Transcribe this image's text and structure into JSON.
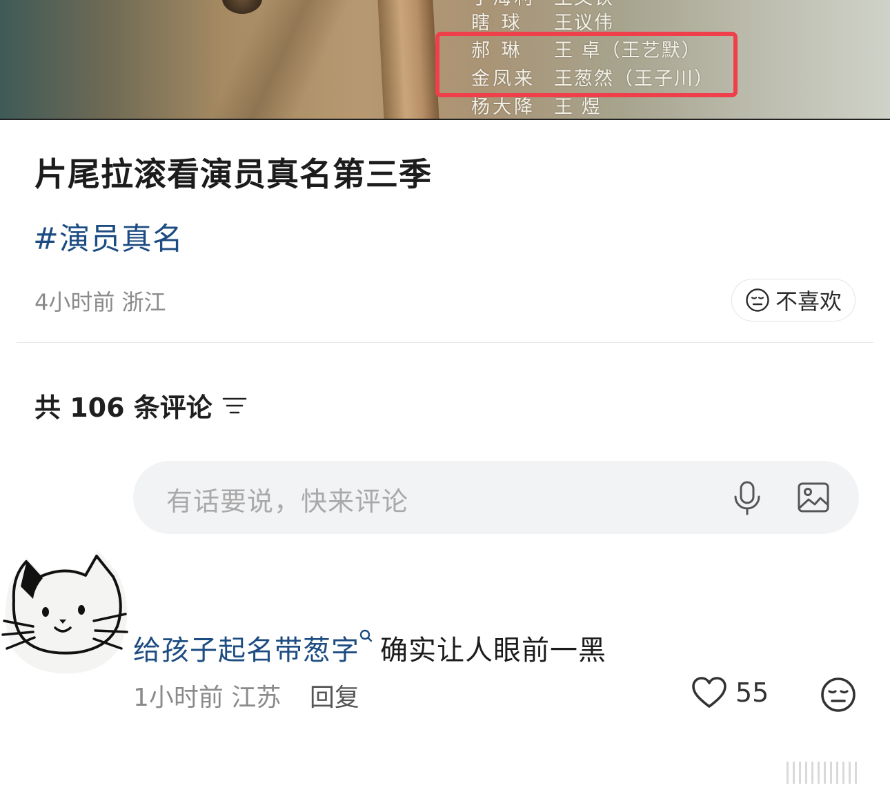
{
  "video": {
    "credits": [
      {
        "role": "于海利",
        "actor": "王文铁"
      },
      {
        "role": "瞎  球",
        "actor": "王议伟"
      },
      {
        "role": "郝  琳",
        "actor": "王  卓（王艺默）"
      },
      {
        "role": "金凤来",
        "actor": "王葱然（王子川）"
      },
      {
        "role": "杨大降",
        "actor": "王  煜"
      }
    ],
    "highlight_color": "#ee3f4b"
  },
  "post": {
    "title": "片尾拉滚看演员真名第三季",
    "hashtag": "#演员真名",
    "meta": "4小时前 浙江",
    "dislike_label": "不喜欢"
  },
  "comments": {
    "count_label": "共 106 条评论",
    "sort_icon": "filter-lines-icon",
    "input_placeholder": "有话要说，快来评论",
    "items": [
      {
        "avatar": "cat-drawing-avatar",
        "link_text": "给孩子起名带葱字",
        "text": "确实让人眼前一黑",
        "time_location": "1小时前 江苏",
        "reply_label": "回复",
        "likes": "55"
      }
    ]
  },
  "colors": {
    "link": "#1d4c82",
    "meta": "#8a8a8a",
    "input_bg": "#f2f3f5"
  }
}
